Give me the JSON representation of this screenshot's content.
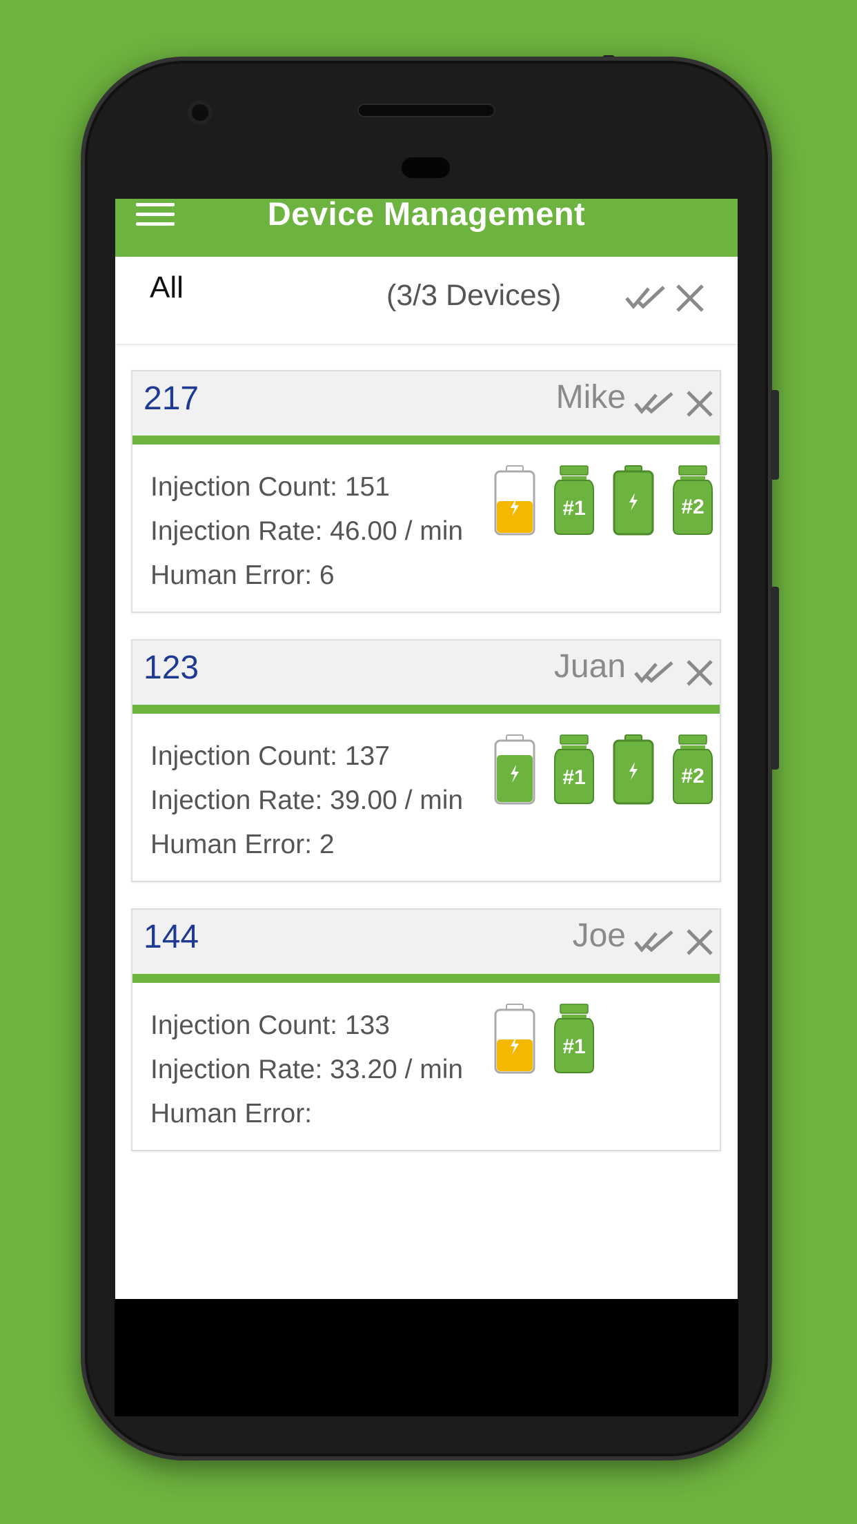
{
  "app": {
    "title": "Device Management"
  },
  "filter": {
    "label": "All",
    "count": "(3/3 Devices)"
  },
  "devices": [
    {
      "id": "217",
      "name": "Mike",
      "injection_count": "Injection Count: 151",
      "injection_rate": "Injection Rate: 46.00 / min",
      "human_error": "Human Error: 6",
      "icons": [
        "battery-low-icon",
        "bottle-1-icon",
        "battery-full-icon",
        "bottle-2-icon"
      ],
      "bottle_1_label": "#1",
      "bottle_2_label": "#2"
    },
    {
      "id": "123",
      "name": "Juan",
      "injection_count": "Injection Count: 137",
      "injection_rate": "Injection Rate: 39.00 / min",
      "human_error": "Human Error: 2",
      "icons": [
        "battery-full-icon",
        "bottle-1-icon",
        "battery-full-icon",
        "bottle-2-icon"
      ],
      "bottle_1_label": "#1",
      "bottle_2_label": "#2"
    },
    {
      "id": "144",
      "name": "Joe",
      "injection_count": "Injection Count: 133",
      "injection_rate": "Injection Rate: 33.20 / min",
      "human_error": "Human Error:",
      "icons": [
        "battery-low-icon",
        "bottle-1-icon"
      ],
      "bottle_1_label": "#1"
    }
  ],
  "colors": {
    "brand_green": "#6db33f",
    "battery_low": "#f5b800",
    "id_blue": "#1f3a93"
  }
}
